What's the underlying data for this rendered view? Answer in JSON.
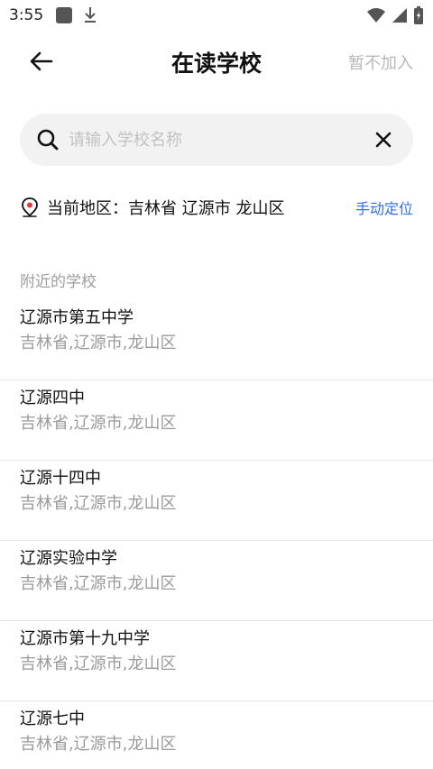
{
  "status_bar": {
    "time": "3:55"
  },
  "header": {
    "title": "在读学校",
    "skip_label": "暂不加入"
  },
  "search": {
    "placeholder": "请输入学校名称",
    "value": ""
  },
  "location": {
    "label": "当前地区：",
    "value": "吉林省 辽源市 龙山区",
    "manual_label": "手动定位"
  },
  "nearby": {
    "title": "附近的学校",
    "schools": [
      {
        "name": "辽源市第五中学",
        "address": "吉林省,辽源市,龙山区"
      },
      {
        "name": "辽源四中",
        "address": "吉林省,辽源市,龙山区"
      },
      {
        "name": "辽源十四中",
        "address": "吉林省,辽源市,龙山区"
      },
      {
        "name": "辽源实验中学",
        "address": "吉林省,辽源市,龙山区"
      },
      {
        "name": "辽源市第十九中学",
        "address": "吉林省,辽源市,龙山区"
      },
      {
        "name": "辽源七中",
        "address": "吉林省,辽源市,龙山区"
      }
    ]
  },
  "colors": {
    "accent": "#2f6fe0",
    "muted_text": "#9a9a9a",
    "search_bg": "#f2f2f3",
    "location_pin": "#e23b3b"
  }
}
